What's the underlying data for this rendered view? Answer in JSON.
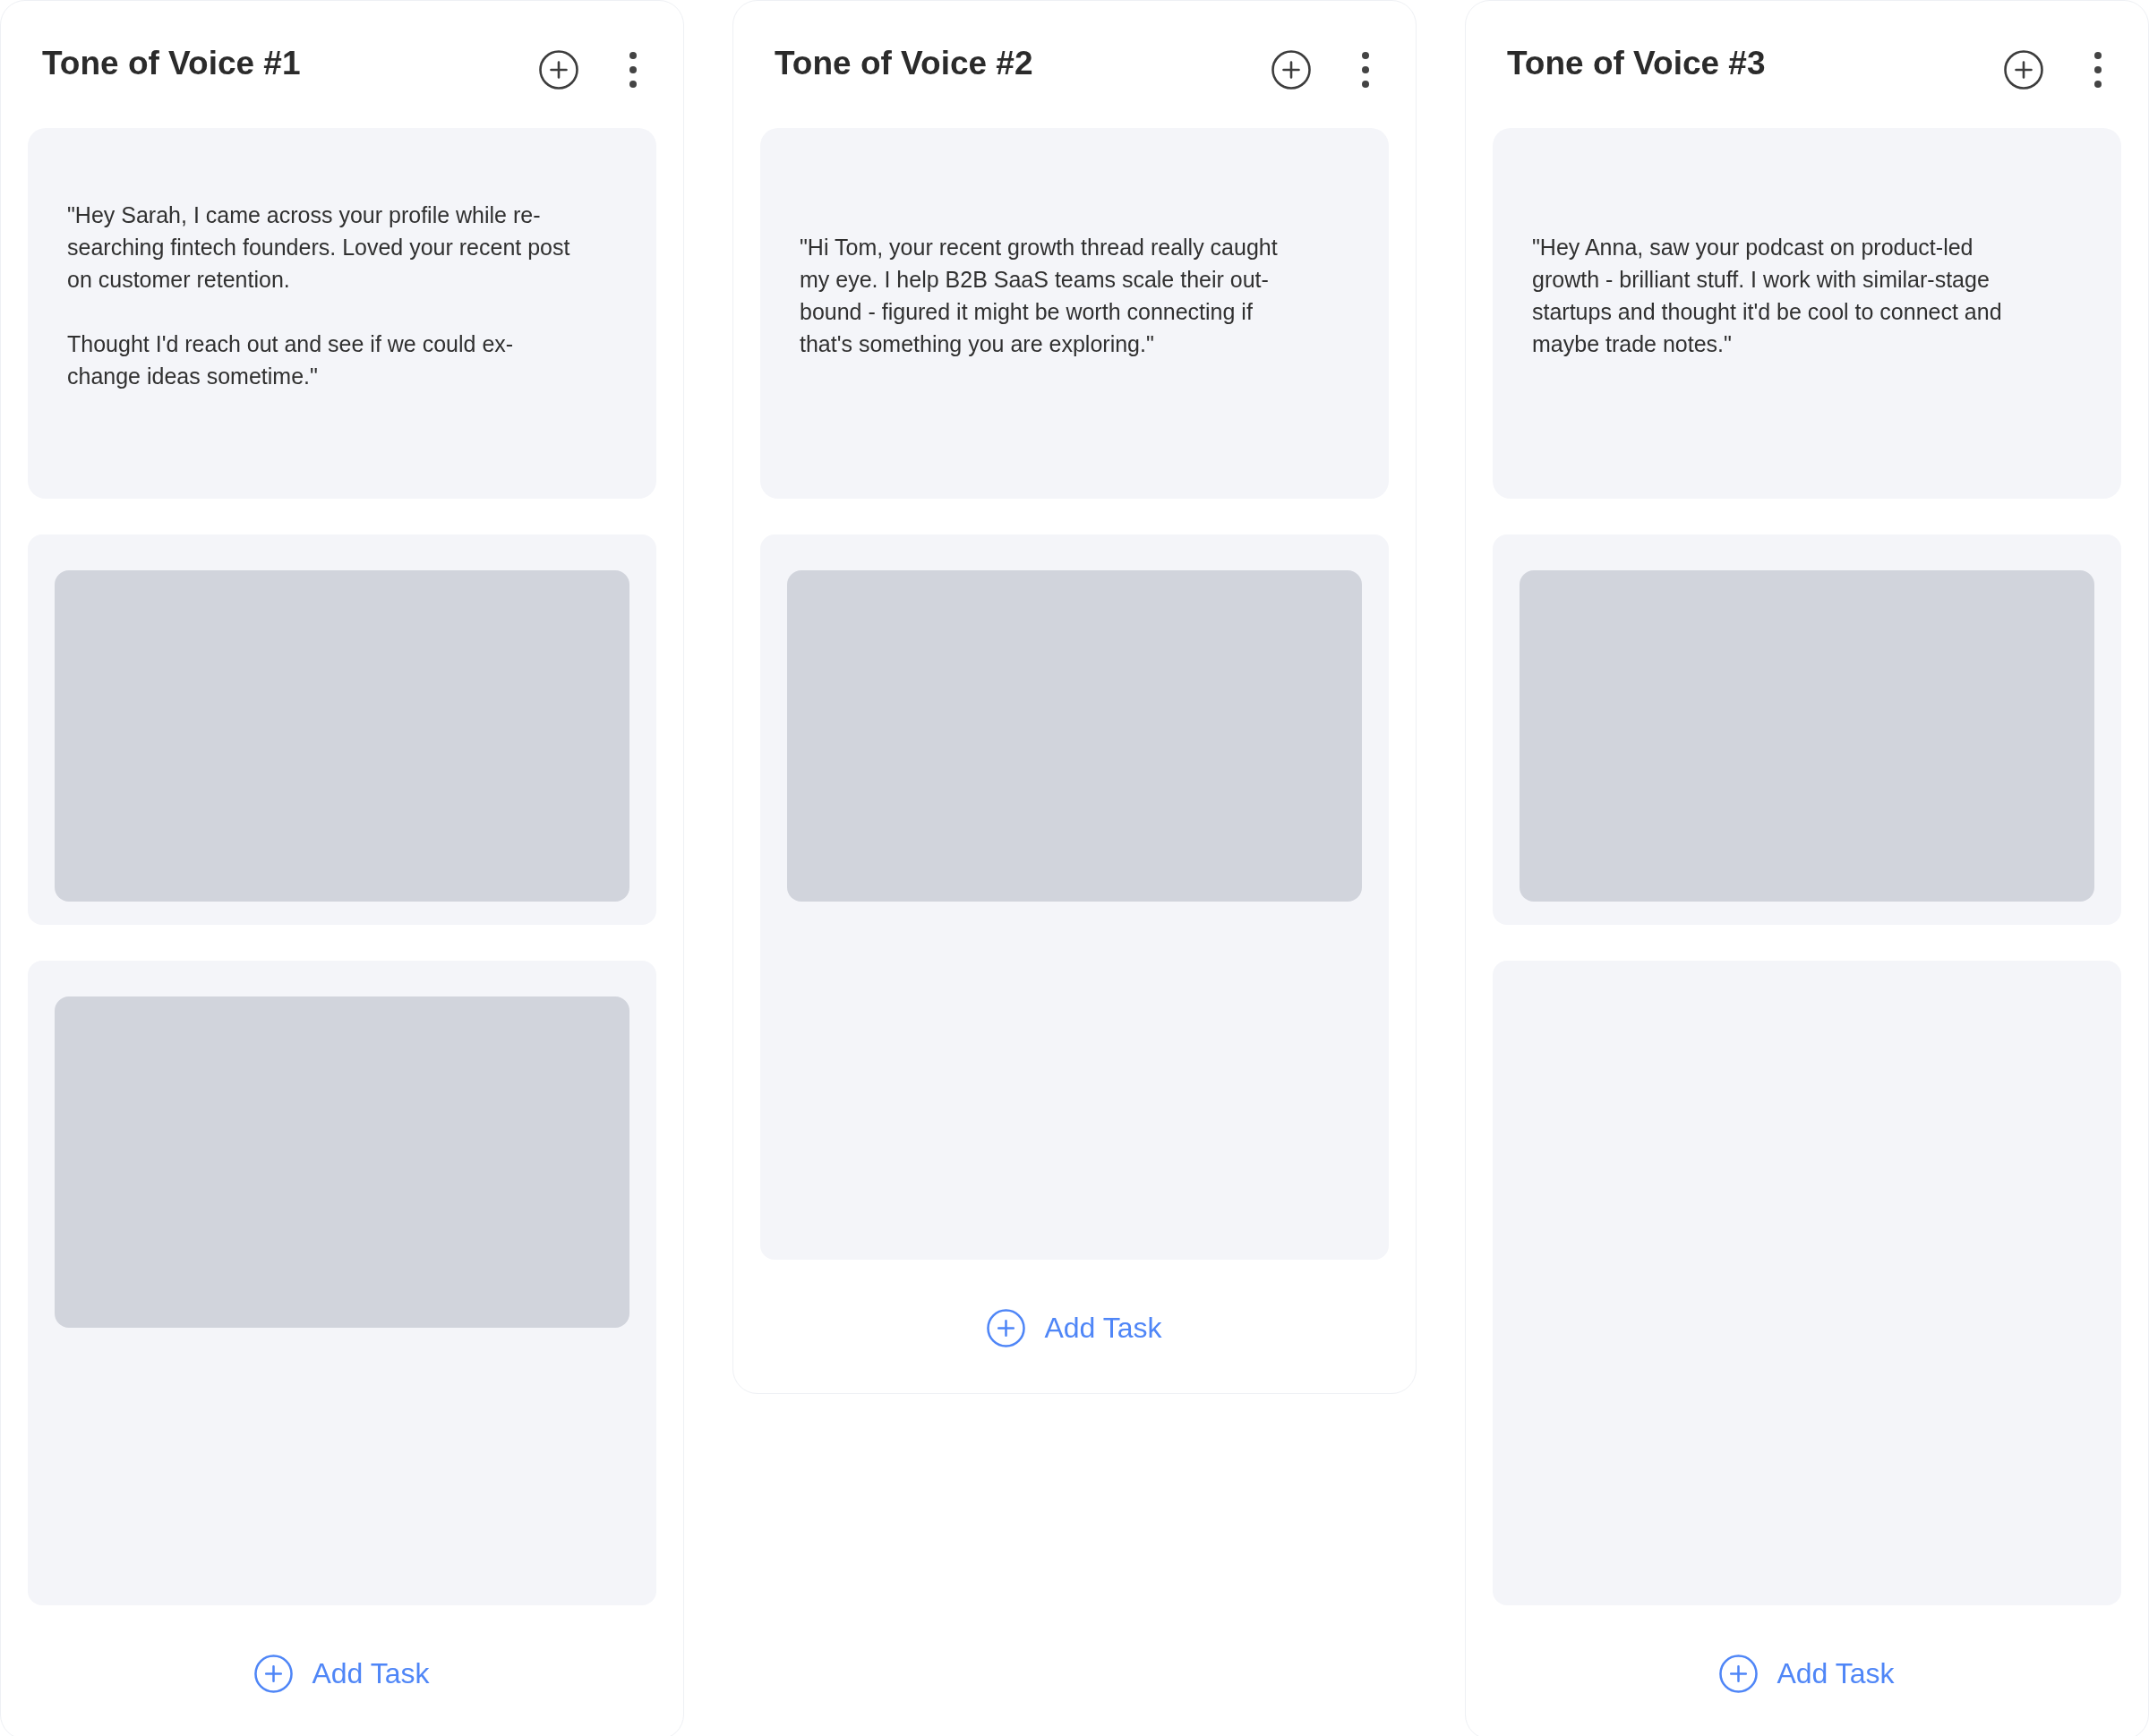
{
  "columns": [
    {
      "title": "Tone of Voice #1",
      "message": "\"Hey Sarah, I came across your profile while re-\nsearching fintech founders. Loved your recent post\non customer retention.\n\nThought I'd reach out and see if we could ex-\nchange ideas sometime.\"",
      "slots": [
        {
          "kind": "skeleton"
        },
        {
          "kind": "skeleton"
        }
      ],
      "add_task": "Add Task"
    },
    {
      "title": "Tone of Voice #2",
      "message": "\"Hi Tom, your recent growth thread really caught\nmy eye. I help B2B SaaS teams scale their out-\nbound - figured it might be worth connecting if\nthat's something you are exploring.\"",
      "slots": [
        {
          "kind": "skeleton"
        }
      ],
      "add_task": "Add Task"
    },
    {
      "title": "Tone of Voice #3",
      "message": "\"Hey Anna, saw your podcast on product-led\ngrowth - brilliant stuff. I work with similar-stage\nstartups and thought it'd be cool to connect and\nmaybe trade notes.\"",
      "slots": [
        {
          "kind": "skeleton"
        },
        {
          "kind": "empty"
        }
      ],
      "add_task": "Add Task"
    }
  ]
}
